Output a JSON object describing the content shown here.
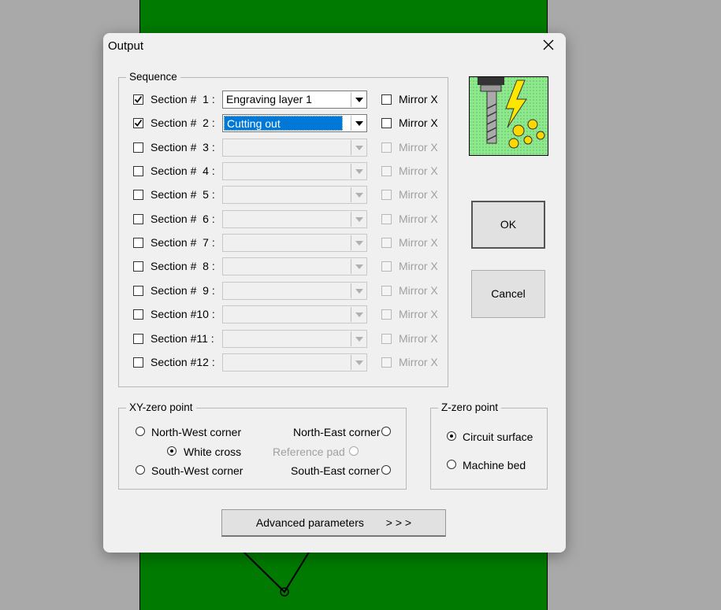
{
  "window": {
    "title": "Output"
  },
  "sequence": {
    "legend": "Sequence",
    "rows": [
      {
        "label": "Section #  1 :",
        "checked": true,
        "value": "Engraving layer 1",
        "mirror": "Mirror X",
        "enabled": true,
        "selected": false
      },
      {
        "label": "Section #  2 :",
        "checked": true,
        "value": "Cutting out",
        "mirror": "Mirror X",
        "enabled": true,
        "selected": true
      },
      {
        "label": "Section #  3 :",
        "checked": false,
        "value": "",
        "mirror": "Mirror X",
        "enabled": false
      },
      {
        "label": "Section #  4 :",
        "checked": false,
        "value": "",
        "mirror": "Mirror X",
        "enabled": false
      },
      {
        "label": "Section #  5 :",
        "checked": false,
        "value": "",
        "mirror": "Mirror X",
        "enabled": false
      },
      {
        "label": "Section #  6 :",
        "checked": false,
        "value": "",
        "mirror": "Mirror X",
        "enabled": false
      },
      {
        "label": "Section #  7 :",
        "checked": false,
        "value": "",
        "mirror": "Mirror X",
        "enabled": false
      },
      {
        "label": "Section #  8 :",
        "checked": false,
        "value": "",
        "mirror": "Mirror X",
        "enabled": false
      },
      {
        "label": "Section #  9 :",
        "checked": false,
        "value": "",
        "mirror": "Mirror X",
        "enabled": false
      },
      {
        "label": "Section #10 :",
        "checked": false,
        "value": "",
        "mirror": "Mirror X",
        "enabled": false
      },
      {
        "label": "Section #11 :",
        "checked": false,
        "value": "",
        "mirror": "Mirror X",
        "enabled": false
      },
      {
        "label": "Section #12 :",
        "checked": false,
        "value": "",
        "mirror": "Mirror X",
        "enabled": false
      }
    ]
  },
  "buttons": {
    "ok": "OK",
    "cancel": "Cancel",
    "advanced": "Advanced parameters",
    "advanced_arrows": "> > >"
  },
  "xy_zero": {
    "legend": "XY-zero point",
    "north_west": "North-West corner",
    "north_east": "North-East corner",
    "white_cross": "White cross",
    "reference_pad": "Reference pad",
    "south_west": "South-West corner",
    "south_east": "South-East corner",
    "selected": "white_cross"
  },
  "z_zero": {
    "legend": "Z-zero point",
    "circuit_surface": "Circuit surface",
    "machine_bed": "Machine bed",
    "selected": "circuit_surface"
  },
  "colors": {
    "board": "#007a00",
    "backdrop": "#a9a9a9",
    "selection": "#0078d7",
    "logo_bg": "#7ee07e"
  },
  "icons": {
    "close": "close-icon",
    "logo": "milling-tool-icon"
  }
}
